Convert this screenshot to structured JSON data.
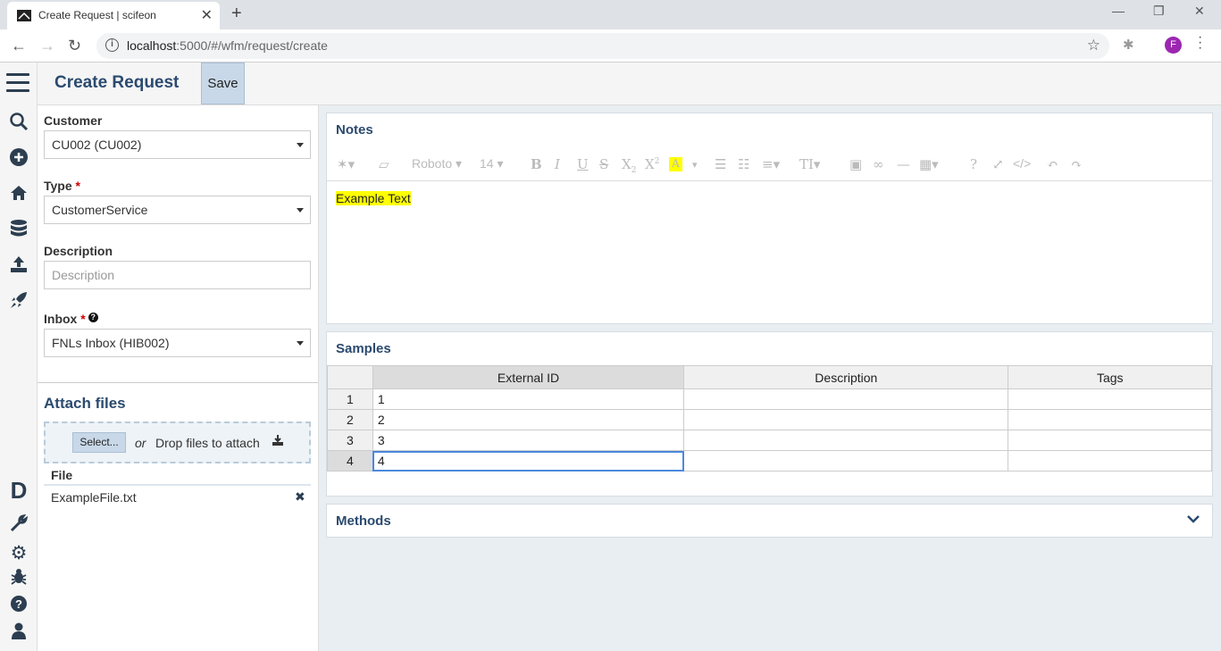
{
  "browser": {
    "tab_title": "Create Request | scifeon",
    "tab_close": "✕",
    "new_tab": "+",
    "url_host": "localhost",
    "url_rest": ":5000/#/wfm/request/create",
    "profile_initial": "F",
    "win_min": "—",
    "win_max": "❐",
    "win_close": "✕"
  },
  "header": {
    "title": "Create Request",
    "save_label": "Save"
  },
  "form": {
    "customer_label": "Customer",
    "customer_value": "CU002 (CU002)",
    "type_label": "Type",
    "type_value": "CustomerService",
    "required_mark": "*",
    "description_label": "Description",
    "description_placeholder": "Description",
    "inbox_label": "Inbox",
    "inbox_value": "FNLs Inbox (HIB002)"
  },
  "attach": {
    "title": "Attach files",
    "select_label": "Select...",
    "or_text": "or",
    "drop_text": "Drop files to attach",
    "file_header": "File",
    "files": [
      "ExampleFile.txt"
    ]
  },
  "notes": {
    "title": "Notes",
    "font_name": "Roboto",
    "font_size": "14",
    "content": "Example Text"
  },
  "samples": {
    "title": "Samples",
    "columns": [
      "External ID",
      "Description",
      "Tags"
    ],
    "rows": [
      {
        "n": "1",
        "external_id": "1",
        "description": "",
        "tags": ""
      },
      {
        "n": "2",
        "external_id": "2",
        "description": "",
        "tags": ""
      },
      {
        "n": "3",
        "external_id": "3",
        "description": "",
        "tags": ""
      },
      {
        "n": "4",
        "external_id": "4",
        "description": "",
        "tags": ""
      }
    ]
  },
  "methods": {
    "title": "Methods"
  },
  "colors": {
    "accent": "#2b4a6f",
    "button": "#c8d8e8",
    "highlight": "#ffff00"
  }
}
